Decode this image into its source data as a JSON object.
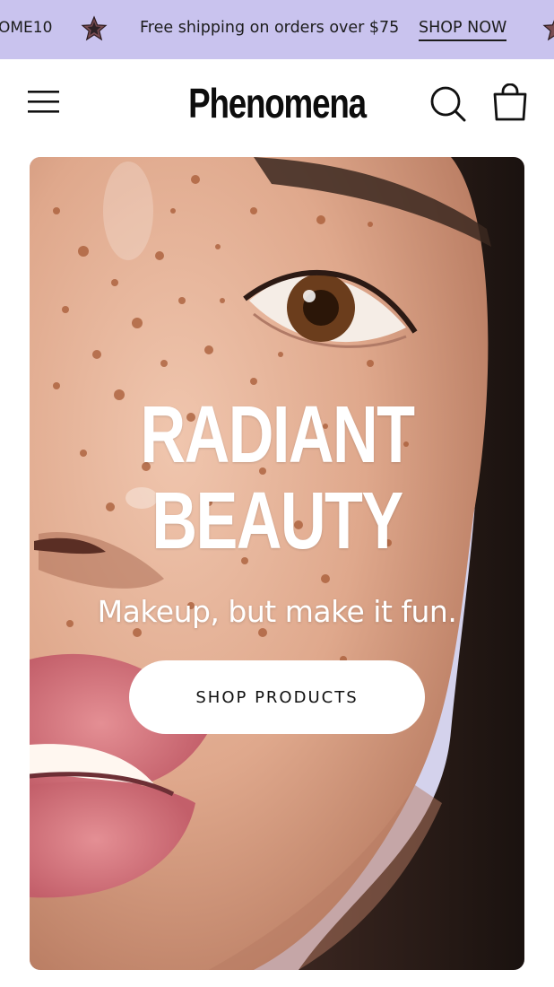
{
  "announcement": {
    "promo_fragment": "OME10",
    "message": "Free shipping on orders over $75",
    "link_label": "SHOP NOW",
    "background": "#c9c3ee",
    "icons": [
      "star-icon",
      "star-icon"
    ]
  },
  "header": {
    "logo": "Phenomena",
    "icons": [
      "menu-icon",
      "search-icon",
      "shopping-bag-icon"
    ]
  },
  "hero": {
    "title_line1": "RADIANT",
    "title_line2": "BEAUTY",
    "subtitle": "Makeup, but make it fun.",
    "cta_label": "SHOP PRODUCTS",
    "image_alt": "Close-up of a freckled face"
  }
}
